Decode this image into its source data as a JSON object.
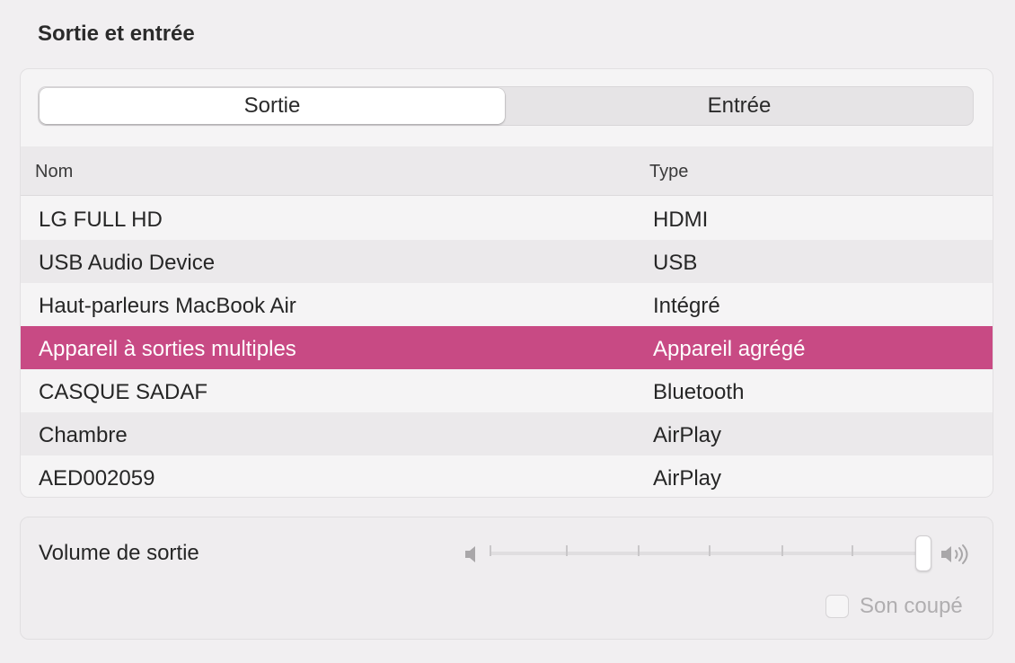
{
  "section": {
    "title": "Sortie et entrée"
  },
  "segmented": {
    "options": [
      "Sortie",
      "Entrée"
    ],
    "selected": "Sortie"
  },
  "table": {
    "columns": {
      "name": "Nom",
      "type": "Type"
    },
    "rows": [
      {
        "name": "LG FULL HD",
        "type": "HDMI"
      },
      {
        "name": "USB Audio Device",
        "type": "USB"
      },
      {
        "name": "Haut-parleurs MacBook Air",
        "type": "Intégré"
      },
      {
        "name": "Appareil à sorties multiples",
        "type": "Appareil agrégé",
        "selected": true
      },
      {
        "name": "CASQUE SADAF",
        "type": "Bluetooth"
      },
      {
        "name": "Chambre",
        "type": "AirPlay"
      },
      {
        "name": "AED002059",
        "type": "AirPlay"
      }
    ],
    "selection_color": "#c84a84"
  },
  "volume": {
    "label": "Volume de sortie",
    "level_percent": 100,
    "low_icon": "speaker-low-icon",
    "high_icon": "speaker-high-icon",
    "mute_label": "Son coupé",
    "mute_checked": false
  }
}
